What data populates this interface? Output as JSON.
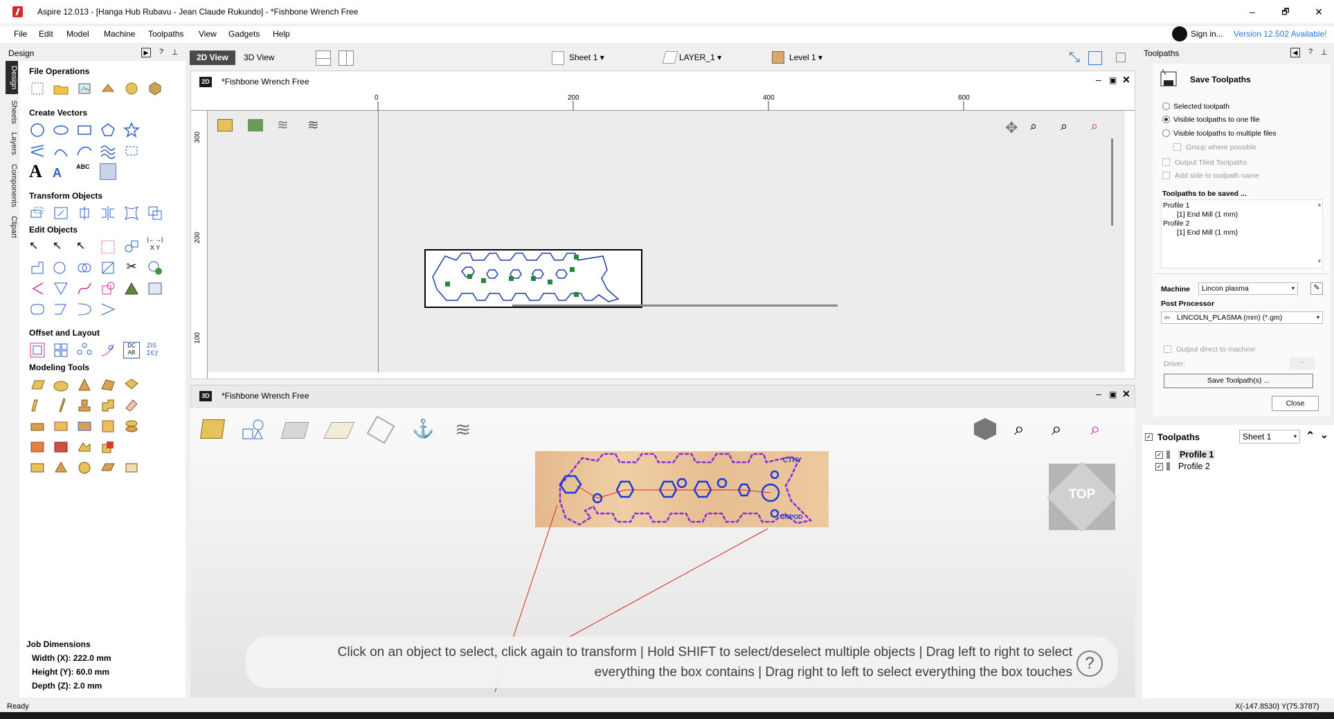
{
  "titlebar": {
    "title": "Aspire 12.013 - [Hanga Hub Rubavu - Jean Claude Rukundo] - *Fishbone Wrench Free",
    "min": "–",
    "max": "🗗",
    "close": "✕"
  },
  "menu": [
    "File",
    "Edit",
    "Model",
    "Machine",
    "Toolpaths",
    "View",
    "Gadgets",
    "Help"
  ],
  "account": {
    "sign_in": "Sign in...",
    "version": "Version 12.502 Available!"
  },
  "design_panel": {
    "title": "Design",
    "tabs": [
      "Design",
      "Sheets",
      "Layers",
      "Components",
      "Clipart"
    ],
    "sections": [
      "File Operations",
      "Create Vectors",
      "Transform Objects",
      "Edit Objects",
      "Offset and Layout",
      "Modeling Tools"
    ],
    "job": {
      "title": "Job Dimensions",
      "width": "Width  (X): 222.0 mm",
      "height": "Height (Y): 60.0 mm",
      "depth": "Depth  (Z): 2.0 mm"
    }
  },
  "viewbar": {
    "view2d": "2D View",
    "view3d": "3D View",
    "sheet": "Sheet 1",
    "layer": "LAYER_1",
    "level": "Level 1"
  },
  "win2d": {
    "badge": "2D",
    "title": "*Fishbone Wrench Free",
    "ruler_x": [
      "0",
      "200",
      "400",
      "600"
    ],
    "ruler_y": [
      "300",
      "200",
      "100"
    ]
  },
  "win3d": {
    "badge": "3D",
    "title": "*Fishbone Wrench Free",
    "top_label": "TOP",
    "text_cthy": "CTHY",
    "text_unpod": "UNPOD"
  },
  "hint": {
    "line1": "Click on an object to select, click again to transform | Hold SHIFT to select/deselect multiple objects | Drag left to right to select",
    "line2": "everything the box contains | Drag right to left to select everything the box touches",
    "help": "?"
  },
  "toolpaths_panel": {
    "title": "Toolpaths",
    "heading": "Save Toolpaths",
    "options": [
      "Selected toolpath",
      "Visible toolpaths to one file",
      "Visible toolpaths to multiple files"
    ],
    "group": "Group where possible",
    "tiled": "Output Tiled Toolpaths",
    "add_side": "Add side to toolpath name",
    "to_be_saved": "Toolpaths to be saved ...",
    "saved_items": [
      "Profile 1",
      "[1] End Mill (1 mm)",
      "Profile 2",
      "[1] End Mill (1 mm)"
    ],
    "machine_label": "Machine",
    "machine_value": "Lincon plasma",
    "post_label": "Post Processor",
    "post_value": "LINCOLN_PLASMA (mm) (*.gm)",
    "direct": "Output direct to machine",
    "driver": "Driver:",
    "driver_btn": "...",
    "save_btn": "Save Toolpath(s) ...",
    "close_btn": "Close"
  },
  "toolpaths_list": {
    "title": "Toolpaths",
    "sheet": "Sheet 1",
    "items": [
      "Profile 1",
      "Profile 2"
    ]
  },
  "status": {
    "left": "Ready",
    "coords": "X(-147.8530) Y(75.3787)"
  }
}
